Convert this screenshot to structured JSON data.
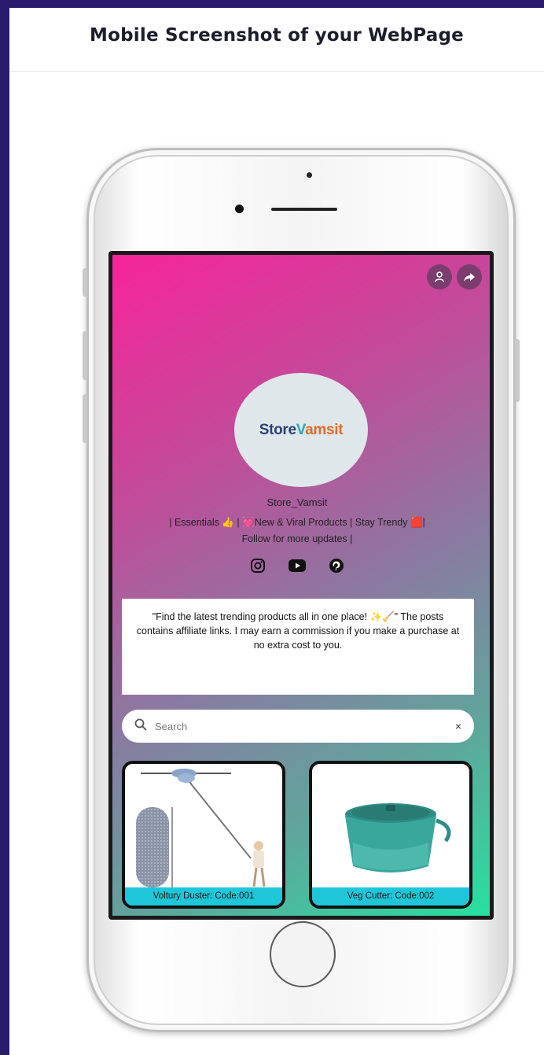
{
  "header": {
    "title": "Mobile Screenshot of your WebPage"
  },
  "profile": {
    "logo": {
      "part1": "Store",
      "part2": "V",
      "part3": "amsit"
    },
    "name": "Store_Vamsit",
    "bio_line1": "| Essentials 👍 | 💓New & Viral Products | Stay Trendy 🟥|",
    "bio_line2": "Follow for more updates |"
  },
  "icons": {
    "profile": "user-icon",
    "share": "share-icon",
    "instagram": "instagram-icon",
    "youtube": "youtube-icon",
    "pinterest": "pinterest-icon",
    "search": "search-icon",
    "clear": "close-icon"
  },
  "info_text": "\"Find the latest trending products all in one place! ✨🧹\" The posts contains affiliate links. I may earn a commission if you make a purchase at no extra cost to you.",
  "search": {
    "placeholder": "Search",
    "clear_label": "×"
  },
  "products": [
    {
      "label": "Voltury Duster: Code:001"
    },
    {
      "label": "Veg Cutter: Code:002"
    }
  ],
  "colors": {
    "frame": "#2a1a6e",
    "gradient_top": "#f7249a",
    "gradient_bottom": "#27e0a0",
    "label_bar": "#1fc6d8"
  }
}
